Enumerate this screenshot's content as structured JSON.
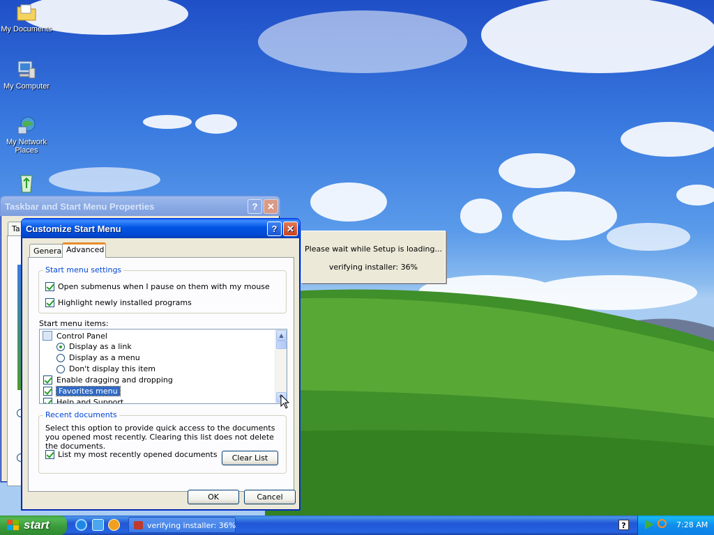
{
  "desktop": {
    "icons": [
      {
        "label": "My Documents"
      },
      {
        "label": "My Computer"
      },
      {
        "label": "My Network Places"
      },
      {
        "label": ""
      }
    ]
  },
  "taskbar_props_window": {
    "title": "Taskbar and Start Menu Properties",
    "tab_fragment": "Ta"
  },
  "customize_window": {
    "title": "Customize Start Menu",
    "help": "?",
    "close": "✕",
    "tabs": [
      "General",
      "Advanced"
    ],
    "start_menu_settings": {
      "title": "Start menu settings",
      "options": [
        {
          "label": "Open submenus when I pause on them with my mouse",
          "checked": true
        },
        {
          "label": "Highlight newly installed programs",
          "checked": true
        }
      ]
    },
    "items_label": "Start menu items:",
    "items": [
      {
        "label": "Control Panel"
      },
      {
        "label": "Display as a link",
        "radio": true,
        "checked": true
      },
      {
        "label": "Display as a menu",
        "radio": true,
        "checked": false
      },
      {
        "label": "Don't display this item",
        "radio": true,
        "checked": false
      },
      {
        "label": "Enable dragging and dropping",
        "checked": true
      },
      {
        "label": "Favorites menu",
        "checked": true,
        "selected": true
      },
      {
        "label": "Help and Support",
        "checked": true
      }
    ],
    "recent": {
      "title": "Recent documents",
      "description": "Select this option to provide quick access to the documents you opened most recently.  Clearing this list does not delete the documents.",
      "list_option": "List my most recently opened documents",
      "clear_button": "Clear List"
    },
    "ok": "OK",
    "cancel": "Cancel"
  },
  "setup_popup": {
    "line1": "Please wait while Setup is loading...",
    "line2": "verifying installer: 36%"
  },
  "taskbar": {
    "start": "start",
    "task_label": "verifying installer: 36%",
    "clock": "7:28 AM",
    "help": "?"
  }
}
